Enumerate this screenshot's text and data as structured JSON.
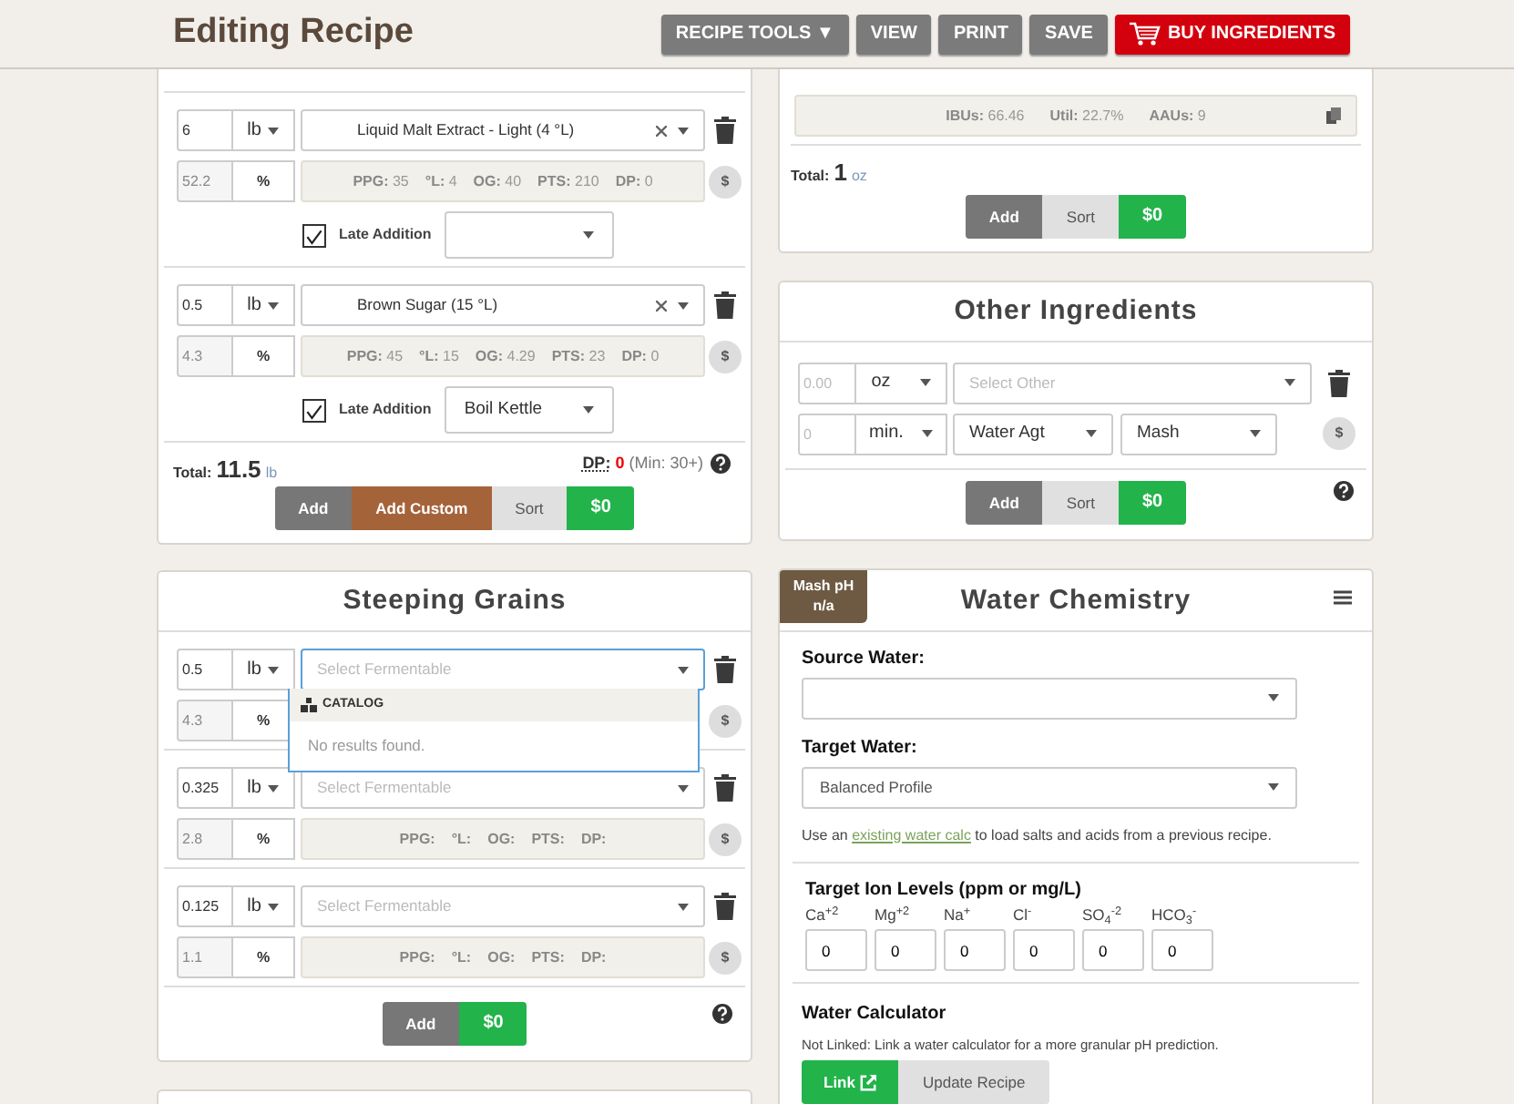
{
  "header": {
    "title": "Editing Recipe",
    "buttons": [
      {
        "label": "RECIPE TOOLS ▼",
        "kind": "plain"
      },
      {
        "label": "VIEW",
        "kind": "plain"
      },
      {
        "label": "PRINT",
        "kind": "plain"
      },
      {
        "label": "SAVE",
        "kind": "plain"
      },
      {
        "label": "BUY INGREDIENTS",
        "kind": "buy"
      }
    ]
  },
  "fermentables": {
    "items": [
      {
        "amount": "6",
        "unit": "lb",
        "name": "Liquid Malt Extract - Light (4 °L)",
        "percent": "52.2",
        "percent_unit": "%",
        "cost": "$",
        "stats": [
          {
            "label": "PPG:",
            "value": "35"
          },
          {
            "label": "°L:",
            "value": "4"
          },
          {
            "label": "OG:",
            "value": "40"
          },
          {
            "label": "PTS:",
            "value": "210"
          },
          {
            "label": "DP:",
            "value": "0"
          }
        ],
        "late_addition": {
          "label": "Late Addition",
          "checked": true
        }
      },
      {
        "amount": "0.5",
        "unit": "lb",
        "name": "Brown Sugar (15 °L)",
        "percent": "4.3",
        "percent_unit": "%",
        "cost": "$",
        "stats": [
          {
            "label": "PPG:",
            "value": "45"
          },
          {
            "label": "°L:",
            "value": "15"
          },
          {
            "label": "OG:",
            "value": "4.29"
          },
          {
            "label": "PTS:",
            "value": "23"
          },
          {
            "label": "DP:",
            "value": "0"
          }
        ],
        "late_addition": {
          "label": "Late Addition",
          "checked": true,
          "stage": "Boil Kettle"
        }
      }
    ],
    "total_label": "Total:",
    "total": "11.5",
    "total_unit": "lb",
    "dp_label": "DP:",
    "dp_value": "0",
    "dp_min": "(Min: 30+)",
    "buttons": [
      {
        "label": "Add",
        "kind": "dark"
      },
      {
        "label": "Add Custom",
        "kind": "brown"
      },
      {
        "label": "Sort",
        "kind": "light"
      },
      {
        "label": "$0",
        "kind": "green"
      }
    ]
  },
  "hops": {
    "stats": [
      {
        "label": "IBUs:",
        "value": "66.46"
      },
      {
        "label": "Util:",
        "value": "22.7%"
      },
      {
        "label": "AAUs:",
        "value": "9"
      }
    ],
    "total_label": "Total:",
    "total": "1",
    "total_unit": "oz",
    "buttons": [
      {
        "label": "Add",
        "kind": "dark"
      },
      {
        "label": "Sort",
        "kind": "light"
      },
      {
        "label": "$0",
        "kind": "green"
      }
    ]
  },
  "other_ingredients": {
    "title": "Other Ingredients",
    "item": {
      "amount_placeholder": "0.00",
      "unit": "oz",
      "select_placeholder": "Select Other",
      "time_placeholder": "0",
      "time_unit": "min.",
      "type": "Water Agt",
      "use": "Mash",
      "cost": "$"
    },
    "buttons": [
      {
        "label": "Add",
        "kind": "dark"
      },
      {
        "label": "Sort",
        "kind": "light"
      },
      {
        "label": "$0",
        "kind": "green"
      }
    ]
  },
  "steeping_grains": {
    "title": "Steeping Grains",
    "items": [
      {
        "amount": "0.5",
        "unit": "lb",
        "placeholder": "Select Fermentable",
        "percent": "4.3",
        "percent_unit": "%",
        "cost": "$",
        "expanded": true,
        "dropdown": {
          "group": "CATALOG",
          "message": "No results found."
        }
      },
      {
        "amount": "0.325",
        "unit": "lb",
        "placeholder": "Select Fermentable",
        "percent": "2.8",
        "percent_unit": "%",
        "cost": "$",
        "expanded": false,
        "stats": [
          {
            "label": "PPG:"
          },
          {
            "label": "°L:"
          },
          {
            "label": "OG:"
          },
          {
            "label": "PTS:"
          },
          {
            "label": "DP:"
          }
        ]
      },
      {
        "amount": "0.125",
        "unit": "lb",
        "placeholder": "Select Fermentable",
        "percent": "1.1",
        "percent_unit": "%",
        "cost": "$",
        "expanded": false,
        "stats": [
          {
            "label": "PPG:"
          },
          {
            "label": "°L:"
          },
          {
            "label": "OG:"
          },
          {
            "label": "PTS:"
          },
          {
            "label": "DP:"
          }
        ]
      }
    ],
    "buttons": [
      {
        "label": "Add",
        "kind": "dark"
      },
      {
        "label": "$0",
        "kind": "green"
      }
    ]
  },
  "water_chemistry": {
    "badge_label": "Mash pH",
    "badge_value": "n/a",
    "title": "Water Chemistry",
    "source_label": "Source Water:",
    "target_label": "Target Water:",
    "target_value": "Balanced Profile",
    "note_before": "Use an",
    "note_link": "existing water calc",
    "note_after": "to load salts and acids from a previous recipe.",
    "ion_heading": "Target Ion Levels (ppm or mg/L)",
    "ions": [
      {
        "label": "Ca$^{+2}$",
        "value": "0"
      },
      {
        "label": "Mg$^{+2}$",
        "value": "0"
      },
      {
        "label": "Na$^{+}$",
        "value": "0"
      },
      {
        "label": "Cl$^{-}$",
        "value": "0"
      },
      {
        "label": "SO$_{4}$$^{-2}$",
        "value": "0"
      },
      {
        "label": "HCO$_{3}$$^{-}$",
        "value": "0"
      }
    ],
    "calculator_title": "Water Calculator",
    "calculator_note": "Not Linked: Link a water calculator for a more granular pH prediction.",
    "buttons": [
      {
        "label": "Link",
        "kind": "link"
      },
      {
        "label": "Update Recipe",
        "kind": "light"
      }
    ]
  }
}
